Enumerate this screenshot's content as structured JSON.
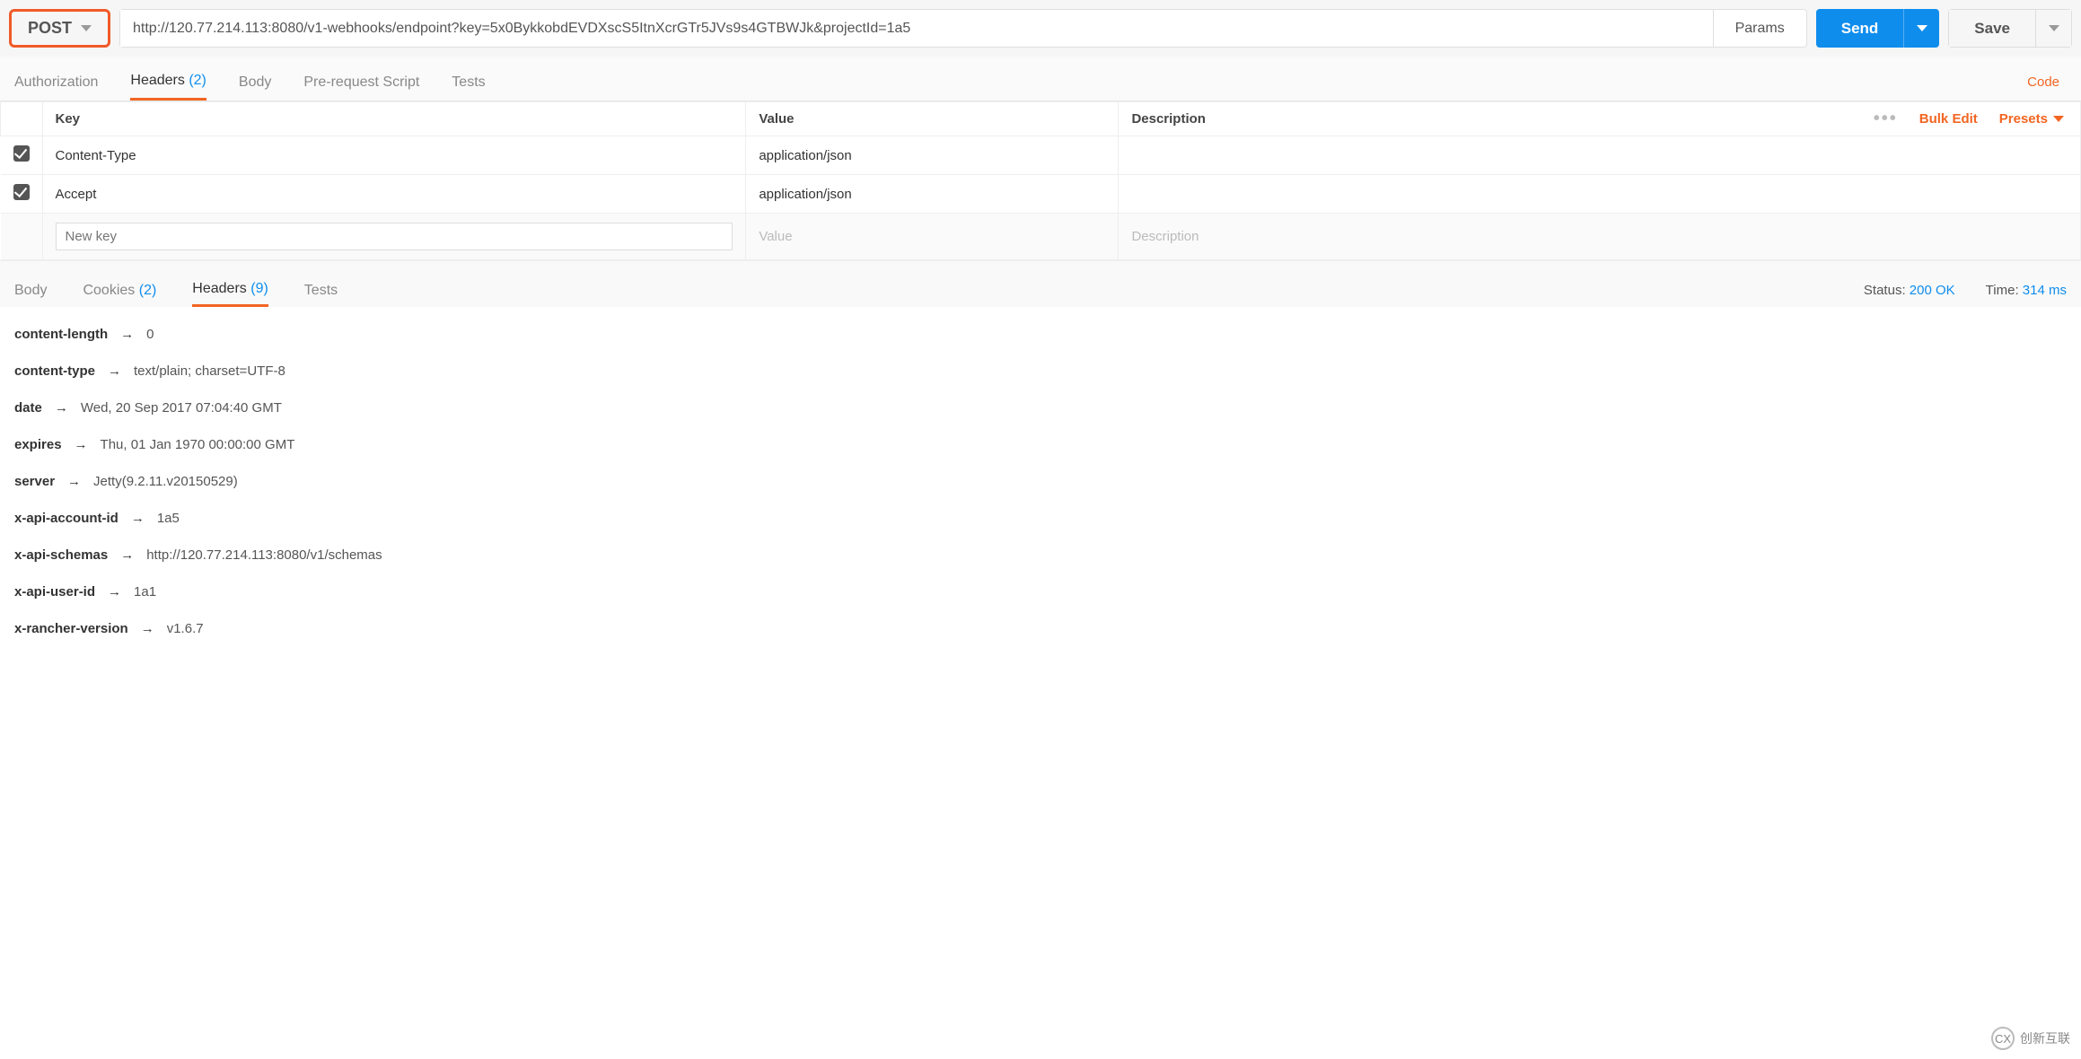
{
  "request": {
    "method": "POST",
    "url": "http://120.77.214.113:8080/v1-webhooks/endpoint?key=5x0BykkobdEVDXscS5ItnXcrGTr5JVs9s4GTBWJk&projectId=1a5",
    "params_btn": "Params",
    "send_btn": "Send",
    "save_btn": "Save"
  },
  "req_tabs": {
    "authorization": "Authorization",
    "headers": "Headers",
    "headers_count": "(2)",
    "body": "Body",
    "prerequest": "Pre-request Script",
    "tests": "Tests",
    "code": "Code"
  },
  "headers_table": {
    "cols": {
      "key": "Key",
      "value": "Value",
      "desc": "Description"
    },
    "actions": {
      "bulk_edit": "Bulk Edit",
      "presets": "Presets"
    },
    "rows": [
      {
        "key": "Content-Type",
        "value": "application/json",
        "desc": ""
      },
      {
        "key": "Accept",
        "value": "application/json",
        "desc": ""
      }
    ],
    "placeholder": {
      "key": "New key",
      "value": "Value",
      "desc": "Description"
    }
  },
  "resp_tabs": {
    "body": "Body",
    "cookies": "Cookies",
    "cookies_count": "(2)",
    "headers": "Headers",
    "headers_count": "(9)",
    "tests": "Tests"
  },
  "status": {
    "status_label": "Status:",
    "status_value": "200 OK",
    "time_label": "Time:",
    "time_value": "314 ms"
  },
  "response_headers": [
    {
      "key": "content-length",
      "value": "0"
    },
    {
      "key": "content-type",
      "value": "text/plain; charset=UTF-8"
    },
    {
      "key": "date",
      "value": "Wed, 20 Sep 2017 07:04:40 GMT"
    },
    {
      "key": "expires",
      "value": "Thu, 01 Jan 1970 00:00:00 GMT"
    },
    {
      "key": "server",
      "value": "Jetty(9.2.11.v20150529)"
    },
    {
      "key": "x-api-account-id",
      "value": "1a5"
    },
    {
      "key": "x-api-schemas",
      "value": "http://120.77.214.113:8080/v1/schemas"
    },
    {
      "key": "x-api-user-id",
      "value": "1a1"
    },
    {
      "key": "x-rancher-version",
      "value": "v1.6.7"
    }
  ],
  "watermark": "创新互联"
}
